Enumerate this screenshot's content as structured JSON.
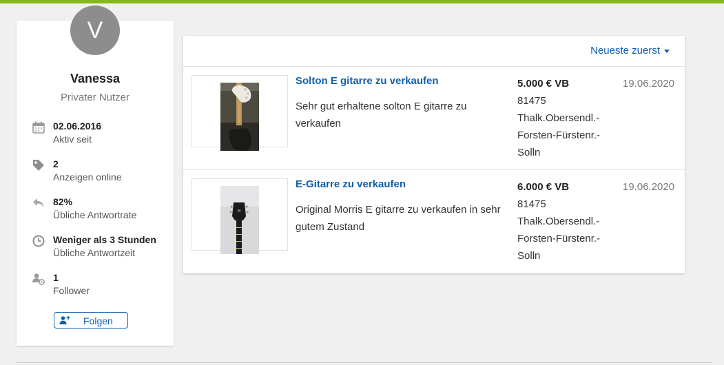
{
  "profile": {
    "avatar_letter": "V",
    "name": "Vanessa",
    "type": "Privater Nutzer",
    "stats": [
      {
        "icon": "calendar-icon",
        "value": "02.06.2016",
        "label": "Aktiv seit"
      },
      {
        "icon": "tag-icon",
        "value": "2",
        "label": "Anzeigen online"
      },
      {
        "icon": "reply-icon",
        "value": "82%",
        "label": "Übliche Antwortrate"
      },
      {
        "icon": "clock-icon",
        "value": "Weniger als 3 Stunden",
        "label": "Übliche Antwortzeit"
      },
      {
        "icon": "followers-icon",
        "value": "1",
        "label": "Follower"
      }
    ],
    "follow_label": "Folgen"
  },
  "listings": {
    "sort_label": "Neueste zuerst",
    "items": [
      {
        "title": "Solton E gitarre zu verkaufen",
        "description": "Sehr gut erhaltene solton E gitarre zu verkaufen",
        "price": "5.000 € VB",
        "location": "81475 Thalk.Obersendl.-Forsten-Fürstenr.-Solln",
        "date": "19.06.2020"
      },
      {
        "title": "E-Gitarre zu verkaufen",
        "description": "Original Morris E gitarre zu verkaufen in sehr gutem Zustand",
        "price": "6.000 € VB",
        "location": "81475 Thalk.Obersendl.-Forsten-Fürstenr.-Solln",
        "date": "19.06.2020"
      }
    ]
  },
  "colors": {
    "accent_green": "#86b817",
    "link_blue": "#0f5fad",
    "avatar_gray": "#8d8d8d"
  }
}
